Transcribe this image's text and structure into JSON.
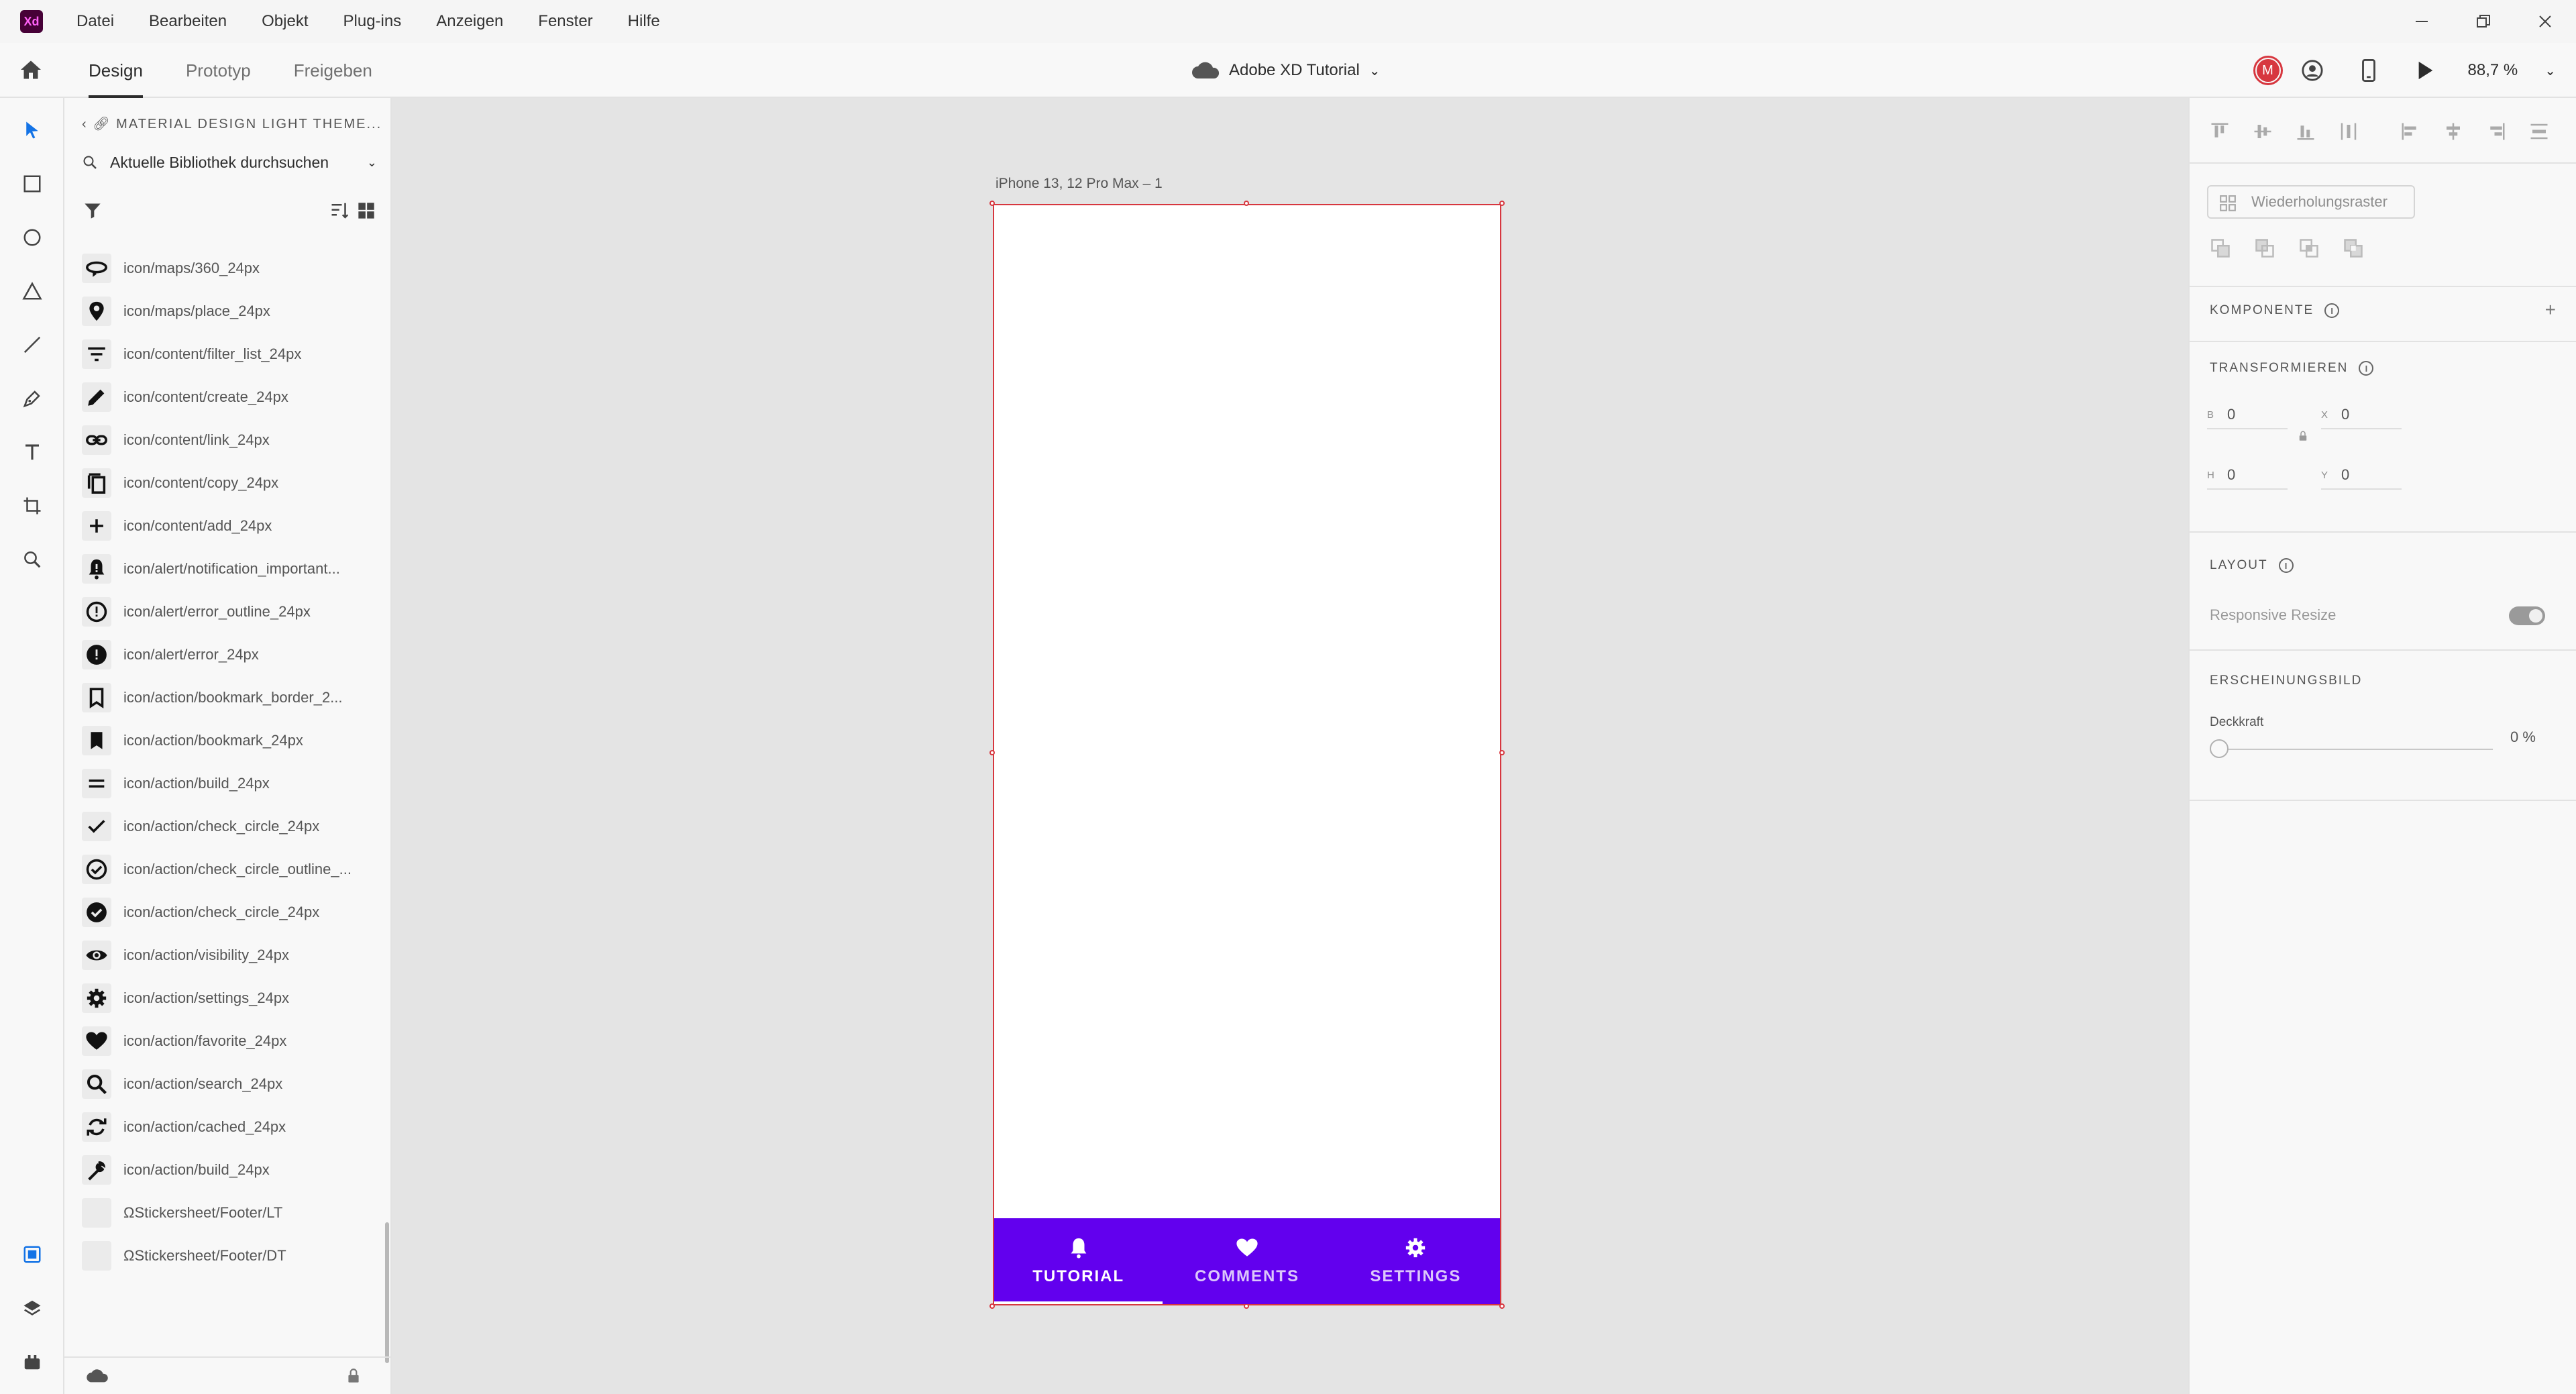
{
  "app": {
    "logo_text": "Xd",
    "menu": [
      "Datei",
      "Bearbeiten",
      "Objekt",
      "Plug-ins",
      "Anzeigen",
      "Fenster",
      "Hilfe"
    ]
  },
  "toolbar": {
    "tabs": [
      {
        "label": "Design",
        "active": true
      },
      {
        "label": "Prototyp",
        "active": false
      },
      {
        "label": "Freigeben",
        "active": false
      }
    ],
    "doc_title": "Adobe XD Tutorial",
    "avatar_initial": "M",
    "zoom": "88,7 %"
  },
  "assets": {
    "library_title": "MATERIAL DESIGN LIGHT THEME...",
    "search_label": "Aktuelle Bibliothek durchsuchen",
    "items": [
      {
        "label": "icon/maps/360_24px",
        "icon": "rotate-360-icon"
      },
      {
        "label": "icon/maps/place_24px",
        "icon": "place-icon"
      },
      {
        "label": "icon/content/filter_list_24px",
        "icon": "filter-list-icon"
      },
      {
        "label": "icon/content/create_24px",
        "icon": "pencil-icon"
      },
      {
        "label": "icon/content/link_24px",
        "icon": "link-icon"
      },
      {
        "label": "icon/content/copy_24px",
        "icon": "copy-icon"
      },
      {
        "label": "icon/content/add_24px",
        "icon": "add-icon"
      },
      {
        "label": "icon/alert/notification_important...",
        "icon": "notification-important-icon"
      },
      {
        "label": "icon/alert/error_outline_24px",
        "icon": "error-outline-icon"
      },
      {
        "label": "icon/alert/error_24px",
        "icon": "error-icon"
      },
      {
        "label": "icon/action/bookmark_border_2...",
        "icon": "bookmark-border-icon"
      },
      {
        "label": "icon/action/bookmark_24px",
        "icon": "bookmark-icon"
      },
      {
        "label": "icon/action/build_24px",
        "icon": "equals-icon"
      },
      {
        "label": "icon/action/check_circle_24px",
        "icon": "check-icon"
      },
      {
        "label": "icon/action/check_circle_outline_...",
        "icon": "check-circle-outline-icon"
      },
      {
        "label": "icon/action/check_circle_24px",
        "icon": "check-circle-icon"
      },
      {
        "label": "icon/action/visibility_24px",
        "icon": "visibility-icon"
      },
      {
        "label": "icon/action/settings_24px",
        "icon": "settings-icon"
      },
      {
        "label": "icon/action/favorite_24px",
        "icon": "heart-icon"
      },
      {
        "label": "icon/action/search_24px",
        "icon": "search-icon"
      },
      {
        "label": "icon/action/cached_24px",
        "icon": "cached-icon"
      },
      {
        "label": "icon/action/build_24px",
        "icon": "wrench-icon"
      },
      {
        "label": "ΩStickersheet/Footer/LT",
        "icon": "blank-thumb"
      },
      {
        "label": "ΩStickersheet/Footer/DT",
        "icon": "blank-thumb"
      }
    ]
  },
  "canvas": {
    "artboard_label": "iPhone 13, 12 Pro Max – 1",
    "nav": [
      {
        "label": "TUTORIAL",
        "icon": "bell-icon",
        "active": true
      },
      {
        "label": "COMMENTS",
        "icon": "heart-icon",
        "active": false
      },
      {
        "label": "SETTINGS",
        "icon": "gear-icon",
        "active": false
      }
    ],
    "nav_color": "#6200ee"
  },
  "props": {
    "repeat_grid": "Wiederholungsraster",
    "component_title": "KOMPONENTE",
    "transform_title": "TRANSFORMIEREN",
    "fields": {
      "w_key": "B",
      "w_val": "0",
      "h_key": "H",
      "h_val": "0",
      "x_key": "X",
      "x_val": "0",
      "y_key": "Y",
      "y_val": "0"
    },
    "layout_title": "LAYOUT",
    "responsive_resize": "Responsive Resize",
    "appearance_title": "ERSCHEINUNGSBILD",
    "opacity_label": "Deckkraft",
    "opacity_value": "0 %"
  },
  "colors": {
    "accent": "#6200ee",
    "selection": "#d7373f",
    "tool_active": "#1473e6"
  }
}
